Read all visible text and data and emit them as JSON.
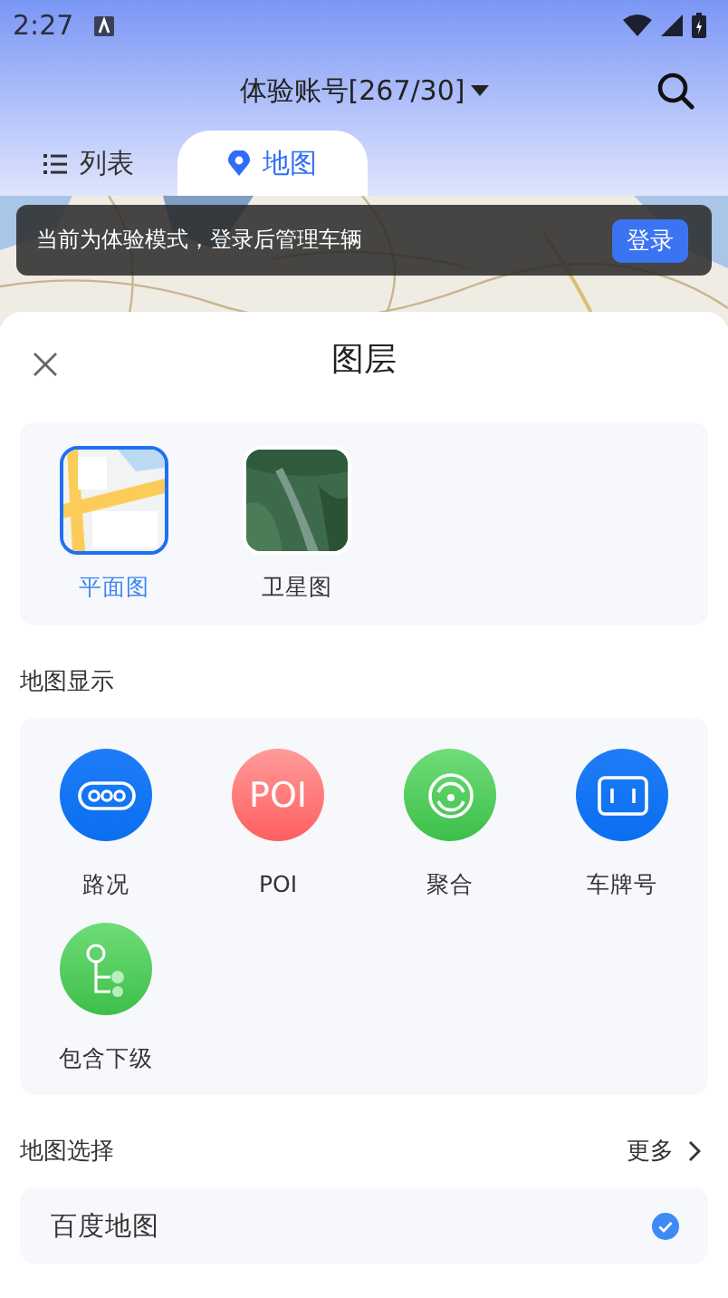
{
  "status_bar": {
    "time": "2:27"
  },
  "header": {
    "title": "体验账号[267/30]"
  },
  "tabs": [
    {
      "label": "列表",
      "kind": "list",
      "selected": false
    },
    {
      "label": "地图",
      "kind": "pin",
      "selected": true
    }
  ],
  "map": {
    "kind": "picture",
    "toast": {
      "text": "当前为体验模式，登录后管理车辆",
      "button": "登录"
    }
  },
  "sheet": {
    "title": "图层",
    "layers": [
      {
        "label": "平面图",
        "kind": "plain",
        "selected": true
      },
      {
        "label": "卫星图",
        "kind": "satellite",
        "selected": false
      }
    ],
    "display_title": "地图显示",
    "display_items": [
      {
        "label": "路况",
        "kind": "traffic"
      },
      {
        "label": "POI",
        "kind": "poi",
        "badge": "POI"
      },
      {
        "label": "聚合",
        "kind": "cluster"
      },
      {
        "label": "车牌号",
        "kind": "plate"
      },
      {
        "label": "包含下级",
        "kind": "sub"
      }
    ],
    "select_title": "地图选择",
    "more": "更多",
    "maps": [
      {
        "label": "百度地图",
        "selected": true
      }
    ]
  }
}
